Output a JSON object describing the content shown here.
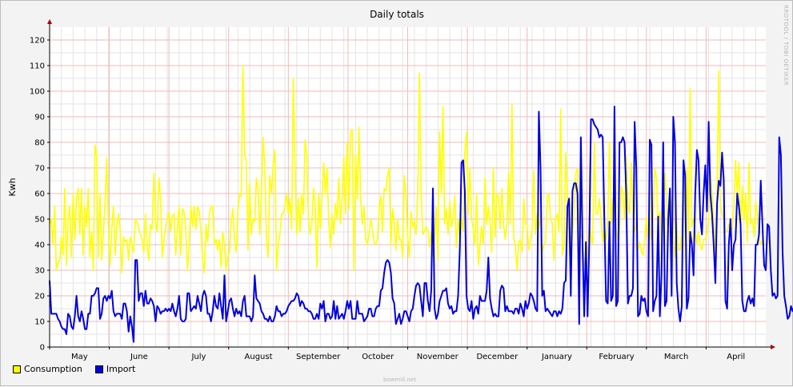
{
  "chart_data": {
    "type": "line",
    "title": "Daily totals",
    "ylabel": "Kwh",
    "xlabel": "",
    "ylim": [
      0,
      125
    ],
    "yticks": [
      0,
      10,
      20,
      30,
      40,
      50,
      60,
      70,
      80,
      90,
      100,
      110,
      120
    ],
    "x_months": [
      "May",
      "June",
      "July",
      "August",
      "September",
      "October",
      "November",
      "December",
      "January",
      "February",
      "March",
      "April"
    ],
    "grid": true,
    "legend_position": "bottom-left",
    "series": [
      {
        "name": "Consumption",
        "color": "#ffff00",
        "values": [
          48,
          50,
          40,
          55,
          30,
          33,
          34,
          43,
          36,
          62,
          32,
          50,
          55,
          35,
          60,
          42,
          58,
          62,
          44,
          62,
          36,
          55,
          47,
          62,
          35,
          45,
          30,
          79,
          75,
          35,
          60,
          34,
          45,
          56,
          74,
          48,
          32,
          46,
          55,
          36,
          48,
          52,
          46,
          29,
          43,
          41,
          42,
          34,
          43,
          40,
          37,
          50,
          49,
          47,
          44,
          42,
          37,
          52,
          40,
          34,
          48,
          46,
          68,
          49,
          45,
          66,
          58,
          35,
          42,
          47,
          50,
          53,
          45,
          51,
          52,
          36,
          46,
          55,
          36,
          54,
          53,
          46,
          30,
          40,
          55,
          47,
          55,
          46,
          55,
          53,
          46,
          34,
          29,
          48,
          41,
          52,
          55,
          55,
          40,
          42,
          38,
          42,
          31,
          45,
          40,
          30,
          35,
          37,
          49,
          54,
          42,
          37,
          53,
          60,
          59,
          110,
          75,
          73,
          38,
          64,
          44,
          50,
          49,
          66,
          62,
          44,
          60,
          82,
          70,
          42,
          35,
          67,
          60,
          71,
          77,
          30,
          40,
          44,
          52,
          52,
          55,
          60,
          52,
          58,
          46,
          105,
          70,
          44,
          58,
          45,
          60,
          52,
          81,
          75,
          50,
          44,
          48,
          62,
          55,
          31,
          60,
          46,
          58,
          72,
          60,
          70,
          49,
          39,
          52,
          44,
          56,
          50,
          66,
          48,
          58,
          74,
          52,
          80,
          54,
          84,
          85,
          30,
          75,
          58,
          86,
          58,
          48,
          55,
          42,
          40,
          44,
          50,
          46,
          41,
          40,
          42,
          54,
          59,
          45,
          62,
          61,
          67,
          70,
          40,
          54,
          48,
          38,
          50,
          42,
          42,
          35,
          67,
          59,
          43,
          35,
          53,
          47,
          49,
          44,
          60,
          107,
          60,
          44,
          45,
          47,
          46,
          39,
          45,
          35,
          43,
          55,
          34,
          84,
          60,
          94,
          48,
          54,
          44,
          57,
          47,
          50,
          59,
          39,
          50,
          43,
          50,
          45,
          76,
          84,
          52,
          70,
          50,
          46,
          40,
          60,
          32,
          40,
          47,
          40,
          66,
          48,
          55,
          49,
          37,
          70,
          43,
          60,
          58,
          46,
          62,
          48,
          42,
          48,
          68,
          48,
          95,
          43,
          40,
          30,
          41,
          42,
          37,
          58,
          48,
          48,
          38,
          42,
          46,
          69,
          44,
          52,
          46,
          52,
          37,
          40,
          41,
          59,
          60,
          50,
          48,
          34,
          50,
          52,
          45,
          93,
          36,
          40,
          76,
          60,
          36,
          35,
          44,
          53,
          68,
          70,
          45,
          44,
          41,
          32,
          36,
          36,
          48,
          43,
          40,
          80,
          52,
          52,
          58,
          50,
          41,
          46,
          42,
          49,
          80,
          48,
          58,
          52,
          46,
          42,
          45,
          63,
          60,
          50,
          75,
          55,
          52,
          72,
          50,
          45,
          48,
          38,
          41,
          37,
          36,
          42,
          51,
          43,
          48,
          42,
          50,
          70,
          66,
          48,
          53,
          40,
          49,
          68,
          58,
          45,
          60,
          55,
          44,
          35,
          49,
          38,
          38,
          44,
          65,
          43,
          70,
          41,
          101,
          47,
          50,
          45,
          40,
          45,
          40,
          38,
          42,
          42,
          44,
          51,
          69,
          60,
          48,
          38,
          60,
          108,
          56,
          52,
          50,
          45,
          45,
          48,
          47,
          46,
          55,
          73,
          60,
          72,
          46,
          63,
          49,
          60,
          41,
          72,
          48,
          50,
          43,
          57,
          52,
          42,
          40,
          42,
          40,
          40
        ]
      },
      {
        "name": "Import",
        "color": "#0000dd",
        "values": [
          26,
          13,
          13,
          13,
          13,
          11,
          10,
          8,
          7,
          7,
          5,
          13,
          12,
          8,
          7,
          12,
          20,
          12,
          10,
          14,
          11,
          7,
          7,
          13,
          13,
          20,
          20,
          21,
          23,
          23,
          11,
          13,
          19,
          20,
          18,
          20,
          19,
          22,
          14,
          12,
          13,
          13,
          13,
          11,
          17,
          17,
          14,
          6,
          12,
          8,
          2,
          34,
          34,
          18,
          21,
          21,
          16,
          22,
          17,
          17,
          19,
          18,
          16,
          10,
          16,
          15,
          13,
          14,
          14,
          15,
          14,
          15,
          14,
          17,
          14,
          12,
          15,
          20,
          11,
          10,
          10,
          11,
          21,
          21,
          14,
          15,
          16,
          15,
          20,
          17,
          14,
          20,
          22,
          20,
          13,
          13,
          10,
          14,
          20,
          16,
          15,
          21,
          16,
          11,
          28,
          10,
          14,
          18,
          19,
          15,
          12,
          15,
          13,
          14,
          12,
          18,
          20,
          12,
          12,
          12,
          10,
          12,
          28,
          19,
          18,
          17,
          14,
          13,
          11,
          11,
          10,
          12,
          10,
          10,
          12,
          16,
          14,
          14,
          12,
          13,
          13,
          14,
          16,
          17,
          18,
          18,
          19,
          21,
          20,
          16,
          18,
          17,
          15,
          15,
          14,
          14,
          13,
          11,
          11,
          13,
          11,
          17,
          15,
          18,
          10,
          13,
          13,
          11,
          12,
          18,
          11,
          16,
          11,
          12,
          13,
          11,
          14,
          18,
          15,
          18,
          11,
          11,
          11,
          18,
          13,
          13,
          13,
          10,
          11,
          12,
          15,
          15,
          12,
          12,
          15,
          16,
          16,
          22,
          23,
          29,
          33,
          34,
          33,
          29,
          19,
          17,
          9,
          11,
          13,
          9,
          11,
          14,
          14,
          12,
          10,
          14,
          15,
          20,
          24,
          25,
          24,
          18,
          12,
          25,
          25,
          18,
          14,
          22,
          62,
          15,
          11,
          13,
          18,
          20,
          22,
          22,
          23,
          17,
          15,
          16,
          13,
          14,
          14,
          20,
          38,
          72,
          73,
          61,
          20,
          15,
          14,
          18,
          11,
          15,
          16,
          13,
          20,
          18,
          18,
          18,
          22,
          35,
          19,
          15,
          12,
          13,
          12,
          12,
          22,
          24,
          23,
          14,
          16,
          14,
          14,
          14,
          13,
          15,
          15,
          13,
          17,
          15,
          12,
          18,
          15,
          17,
          21,
          20,
          18,
          15,
          14,
          92,
          70,
          20,
          22,
          14,
          15,
          14,
          13,
          12,
          14,
          14,
          12,
          14,
          13,
          15,
          25,
          26,
          55,
          58,
          20,
          61,
          64,
          64,
          60,
          9,
          82,
          40,
          12,
          41,
          12,
          41,
          89,
          89,
          87,
          86,
          85,
          82,
          83,
          82,
          49,
          18,
          17,
          49,
          18,
          20,
          94,
          16,
          18,
          80,
          80,
          82,
          80,
          60,
          17,
          20,
          20,
          23,
          88,
          70,
          12,
          13,
          20,
          18,
          19,
          14,
          12,
          81,
          79,
          14,
          18,
          20,
          51,
          12,
          28,
          80,
          16,
          18,
          50,
          62,
          20,
          90,
          80,
          25,
          15,
          10,
          16,
          73,
          67,
          15,
          19,
          45,
          40,
          28,
          60,
          77,
          73,
          50,
          44,
          60,
          71,
          53,
          88,
          60,
          52,
          40,
          25,
          56,
          65,
          63,
          76,
          65,
          18,
          15,
          40,
          50,
          30,
          40,
          42,
          60,
          55,
          48,
          18,
          14,
          14,
          18,
          20,
          17,
          19,
          16,
          40,
          40,
          44,
          65,
          48,
          32,
          30,
          48,
          47,
          30,
          20,
          21,
          19,
          20,
          82,
          75,
          37,
          20,
          16,
          11,
          12,
          16,
          14,
          16,
          15,
          13,
          20,
          24,
          14,
          12,
          15,
          10,
          14,
          18,
          15,
          14,
          14,
          20,
          38,
          47,
          48,
          50,
          46,
          38,
          34,
          24,
          17,
          18,
          18,
          20,
          15,
          16,
          18,
          10,
          12,
          10,
          11,
          20,
          16,
          14,
          13,
          13,
          12,
          11,
          10,
          10,
          11,
          18,
          17,
          14,
          15,
          17,
          16,
          60,
          40,
          32,
          28,
          20,
          32,
          34,
          28,
          60,
          40,
          32,
          31,
          60,
          65,
          65,
          40,
          44,
          50,
          37,
          16,
          15,
          17,
          17,
          16,
          16,
          16,
          14,
          16,
          16,
          20,
          20,
          22,
          22,
          18,
          15,
          16,
          15,
          20,
          21,
          20,
          12,
          14,
          14,
          17,
          18,
          18,
          11,
          12,
          14,
          14,
          10,
          13,
          15,
          16,
          10,
          14,
          12,
          10,
          9,
          11,
          10,
          20,
          21,
          20,
          13,
          13,
          11,
          13,
          14,
          16,
          14,
          16,
          14,
          17,
          12,
          12,
          13,
          14,
          14,
          12,
          10,
          16,
          14,
          16,
          13,
          10,
          11,
          10,
          15,
          15,
          13,
          18,
          22,
          20,
          14,
          13,
          19,
          13,
          12,
          11,
          11,
          10,
          12,
          13,
          16,
          12,
          12,
          10,
          22,
          22,
          22,
          15,
          17,
          14,
          18,
          19,
          20,
          12,
          13,
          18,
          20,
          23,
          25,
          18,
          16,
          17,
          16,
          15,
          14,
          18,
          13,
          14,
          10,
          9,
          9,
          10,
          12
        ]
      }
    ]
  },
  "watermark": "RRDTOOL / TOBI OETIKER",
  "footer": "bowmill.net"
}
